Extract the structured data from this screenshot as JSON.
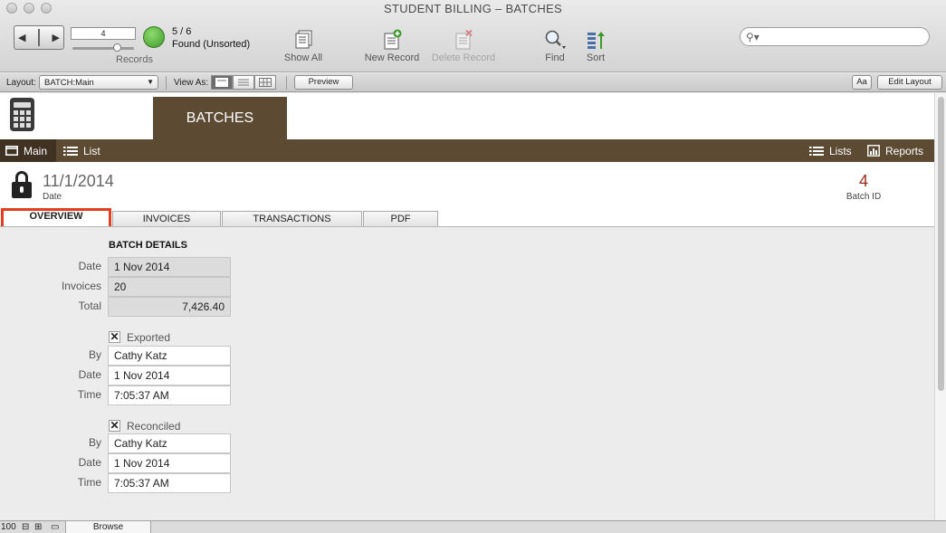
{
  "window": {
    "title": "STUDENT BILLING – BATCHES"
  },
  "toolbar": {
    "record_current": "4",
    "records_label": "Records",
    "found_count": "5 / 6",
    "found_status": "Found (Unsorted)",
    "show_all": "Show All",
    "new_record": "New Record",
    "delete_record": "Delete Record",
    "find": "Find",
    "sort": "Sort",
    "search_placeholder": ""
  },
  "layoutbar": {
    "layout_label": "Layout:",
    "layout_value": "BATCH:Main",
    "view_as_label": "View As:",
    "preview": "Preview",
    "font_button": "Aa",
    "edit_layout": "Edit Layout"
  },
  "header": {
    "tab_title": "BATCHES",
    "nav_main": "Main",
    "nav_list": "List",
    "nav_lists": "Lists",
    "nav_reports": "Reports"
  },
  "record": {
    "date": "11/1/2014",
    "date_caption": "Date",
    "batch_id": "4",
    "batch_id_caption": "Batch ID"
  },
  "tabs": [
    {
      "label": "OVERVIEW",
      "active": true
    },
    {
      "label": "INVOICES",
      "active": false
    },
    {
      "label": "TRANSACTIONS",
      "active": false
    },
    {
      "label": "PDF",
      "active": false
    }
  ],
  "details": {
    "section_title": "BATCH DETAILS",
    "date_label": "Date",
    "date_value": "1 Nov 2014",
    "invoices_label": "Invoices",
    "invoices_value": "20",
    "total_label": "Total",
    "total_value": "7,426.40"
  },
  "exported": {
    "checkbox_label": "Exported",
    "checked": true,
    "by_label": "By",
    "by_value": "Cathy Katz",
    "date_label": "Date",
    "date_value": "1 Nov 2014",
    "time_label": "Time",
    "time_value": "7:05:37 AM"
  },
  "reconciled": {
    "checkbox_label": "Reconciled",
    "checked": true,
    "by_label": "By",
    "by_value": "Cathy Katz",
    "date_label": "Date",
    "date_value": "1 Nov 2014",
    "time_label": "Time",
    "time_value": "7:05:37 AM"
  },
  "statusbar": {
    "zoom": "100",
    "mode": "Browse"
  },
  "colors": {
    "brand_brown": "#5d4a32",
    "batch_id_red": "#9d2a1c",
    "highlight_red": "#e33d20"
  }
}
